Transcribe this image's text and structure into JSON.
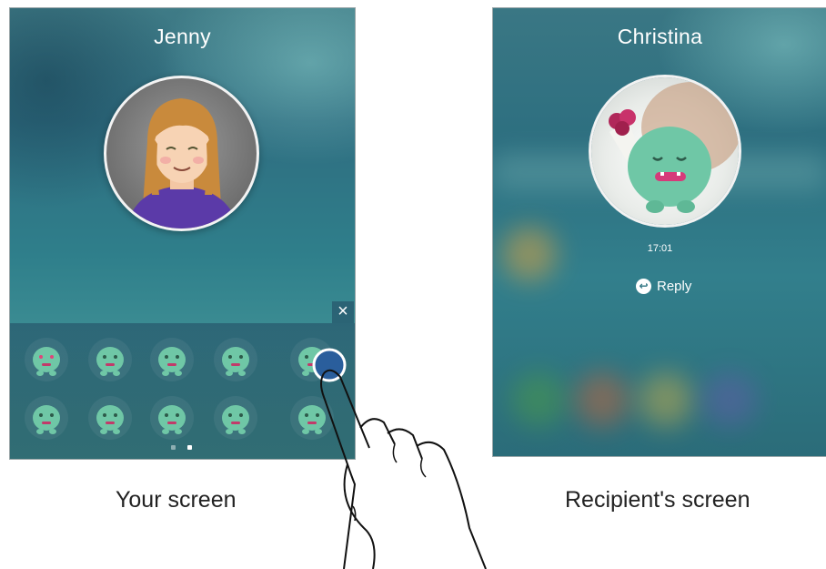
{
  "left_screen": {
    "contact_name": "Jenny",
    "close_glyph": "×",
    "stickers": [
      {
        "name": "sticker-heart-eyes-monster"
      },
      {
        "name": "sticker-sad-monster"
      },
      {
        "name": "sticker-crying-monster"
      },
      {
        "name": "sticker-surprised-monster"
      },
      {
        "name": "sticker-flower-monster"
      },
      {
        "name": "sticker-singing-monster"
      },
      {
        "name": "sticker-wink-monster"
      },
      {
        "name": "sticker-laughing-monster"
      },
      {
        "name": "sticker-kiss-monster"
      },
      {
        "name": "sticker-waving-monster"
      }
    ],
    "page_indicator": {
      "pages": 2,
      "current": 2
    }
  },
  "right_screen": {
    "contact_name": "Christina",
    "time": "17:01",
    "reply_label": "Reply",
    "reply_icon": "reply-icon"
  },
  "captions": {
    "left": "Your screen",
    "right": "Recipient's screen"
  },
  "colors": {
    "monster_green": "#6fc7a6",
    "teal_background": "#2f7f8b"
  }
}
